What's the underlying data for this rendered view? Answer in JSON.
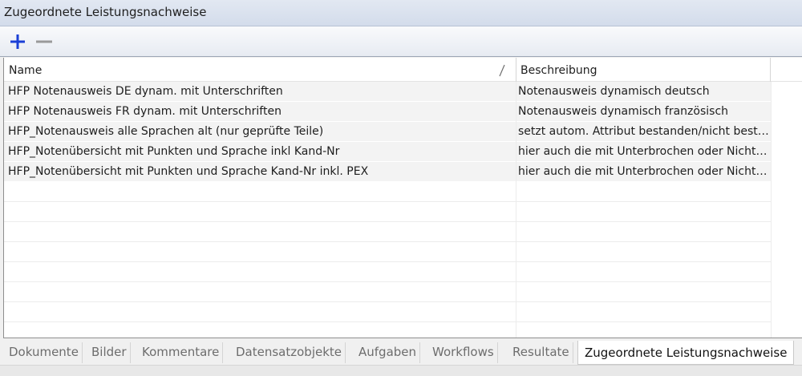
{
  "panel": {
    "title": "Zugeordnete Leistungsnachweise"
  },
  "toolbar": {
    "add_icon": "plus-icon",
    "remove_icon": "minus-icon",
    "add_color": "#1a3fd6",
    "remove_color": "#9a9a9a"
  },
  "table": {
    "columns": [
      {
        "label": "Name"
      },
      {
        "label": "Beschreibung"
      }
    ],
    "rows": [
      {
        "name": "HFP Notenausweis DE dynam. mit Unterschriften",
        "description": "Notenausweis dynamisch deutsch"
      },
      {
        "name": "HFP Notenausweis FR dynam. mit Unterschriften",
        "description": "Notenausweis dynamisch französisch"
      },
      {
        "name": "HFP_Notenausweis alle Sprachen alt (nur geprüfte Teile)",
        "description": "setzt autom. Attribut bestanden/nicht besta..."
      },
      {
        "name": "HFP_Notenübersicht mit Punkten und Sprache inkl Kand-Nr",
        "description": "hier auch die mit Unterbrochen oder Nicht z..."
      },
      {
        "name": "HFP_Notenübersicht mit Punkten und Sprache Kand-Nr inkl. PEX",
        "description": "hier auch die mit Unterbrochen oder Nicht z..."
      }
    ]
  },
  "tabs": [
    {
      "label": "Dokumente"
    },
    {
      "label": "Bilder"
    },
    {
      "label": "Kommentare"
    },
    {
      "label": "Datensatzobjekte"
    },
    {
      "label": "Aufgaben"
    },
    {
      "label": "Workflows"
    },
    {
      "label": "Resultate"
    },
    {
      "label": "Zugeordnete Leistungsnachweise",
      "active": true
    }
  ]
}
